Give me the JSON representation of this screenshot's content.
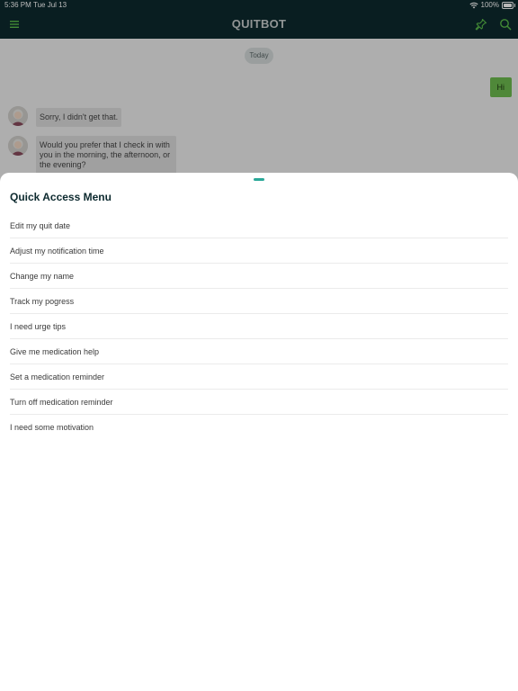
{
  "status_bar": {
    "time": "5:36 PM",
    "date": "Tue Jul 13",
    "battery": "100%"
  },
  "navbar": {
    "title": "QUITBOT",
    "left_icon": "hamburger-menu-icon",
    "right_icons": [
      "pin-icon",
      "search-icon"
    ],
    "accent_color": "#5cc04a"
  },
  "chat": {
    "date_label": "Today",
    "messages": [
      {
        "from": "user",
        "text": "Hi"
      },
      {
        "from": "bot",
        "text": "Sorry, I didn't get that."
      },
      {
        "from": "bot",
        "text": "Would you prefer that I check in with you in the morning, the afternoon, or the evening?"
      }
    ]
  },
  "quick_access": {
    "title": "Quick Access Menu",
    "items": [
      "Edit my quit date",
      "Adjust my notification time",
      "Change my name",
      "Track my pogress",
      "I need urge tips",
      "Give me medication help",
      "Set a medication reminder",
      "Turn off medication reminder",
      "I need some motivation"
    ]
  },
  "colors": {
    "header_bg": "#0d2a2f",
    "user_bubble": "#6ebd4f",
    "bot_bubble": "#dedede",
    "grabber": "#2aa898"
  }
}
